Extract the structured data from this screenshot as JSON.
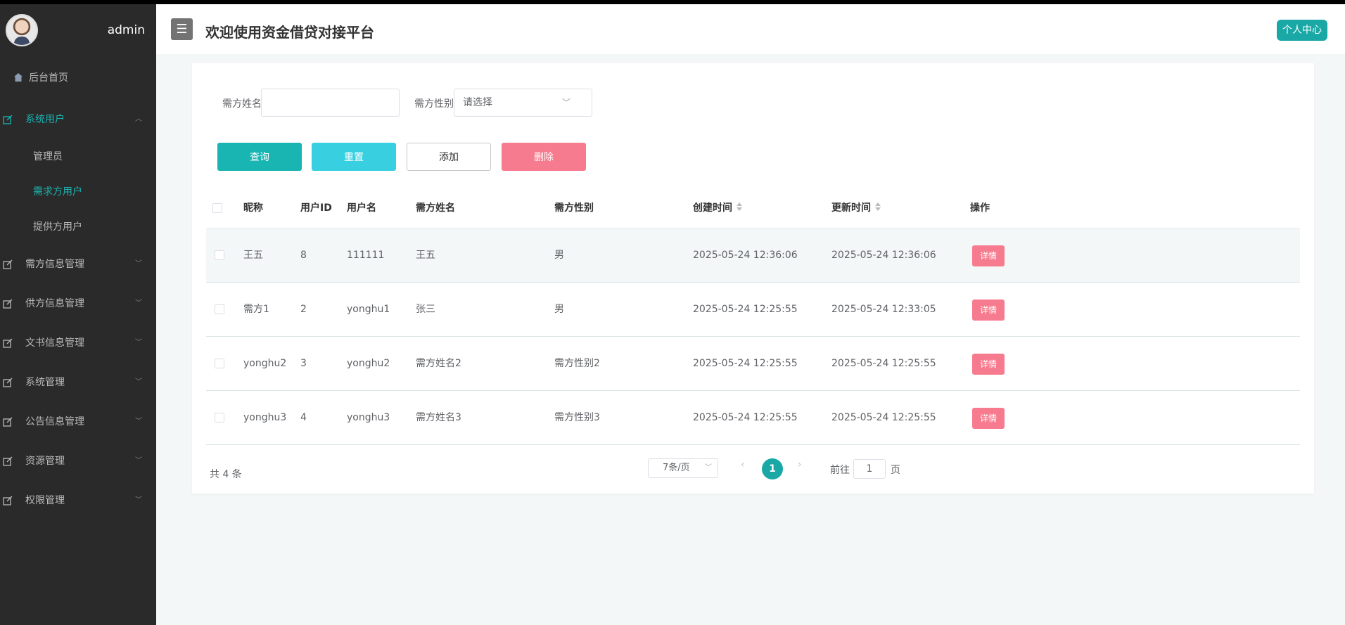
{
  "sidebar": {
    "admin_name": "admin",
    "home": "后台首页",
    "menus": [
      {
        "label": "系统用户",
        "children": [
          "管理员",
          "需求方用户",
          "提供方用户"
        ]
      },
      {
        "label": "需方信息管理"
      },
      {
        "label": "供方信息管理"
      },
      {
        "label": "文书信息管理"
      },
      {
        "label": "系统管理"
      },
      {
        "label": "公告信息管理"
      },
      {
        "label": "资源管理"
      },
      {
        "label": "权限管理"
      }
    ]
  },
  "header": {
    "menu_icon": "☰",
    "title": "欢迎使用资金借贷对接平台",
    "center_button": "个人中心"
  },
  "filter": {
    "name_label": "需方姓名",
    "name_value": "",
    "gender_label": "需方性别",
    "gender_placeholder": "请选择"
  },
  "actions": {
    "query": "查询",
    "reset": "重置",
    "add": "添加",
    "delete": "删除"
  },
  "table": {
    "headers": [
      "昵称",
      "用户ID",
      "用户名",
      "需方姓名",
      "需方性别",
      "创建时间",
      "更新时间",
      "操作"
    ],
    "rows": [
      [
        "王五",
        "8",
        "111111",
        "王五",
        "男",
        "2025-05-24 12:36:06",
        "2025-05-24 12:36:06"
      ],
      [
        "需方1",
        "2",
        "yonghu1",
        "张三",
        "男",
        "2025-05-24 12:25:55",
        "2025-05-24 12:33:05"
      ],
      [
        "yonghu2",
        "3",
        "yonghu2",
        "需方姓名2",
        "需方性别2",
        "2025-05-24 12:25:55",
        "2025-05-24 12:25:55"
      ],
      [
        "yonghu3",
        "4",
        "yonghu3",
        "需方姓名3",
        "需方性别3",
        "2025-05-24 12:25:55",
        "2025-05-24 12:25:55"
      ]
    ],
    "detail_label": "详情"
  },
  "pager": {
    "total": "共 4 条",
    "page_size": "7条/页",
    "current_page": "1",
    "goto_label": "前往",
    "goto_value": "1",
    "goto_suffix": "页"
  },
  "colors": {
    "accent": "#19a8a6",
    "danger": "#f77b8e",
    "sidebar": "#2a2a2a"
  }
}
